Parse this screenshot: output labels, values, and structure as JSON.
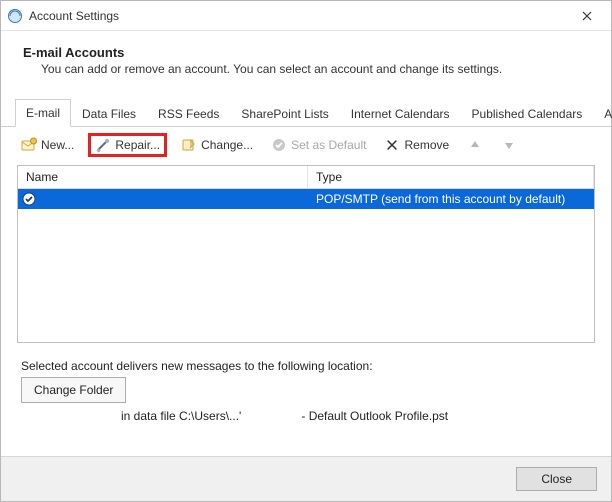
{
  "window": {
    "title": "Account Settings"
  },
  "header": {
    "title": "E-mail Accounts",
    "subtitle": "You can add or remove an account. You can select an account and change its settings."
  },
  "tabs": [
    {
      "label": "E-mail",
      "active": true
    },
    {
      "label": "Data Files"
    },
    {
      "label": "RSS Feeds"
    },
    {
      "label": "SharePoint Lists"
    },
    {
      "label": "Internet Calendars"
    },
    {
      "label": "Published Calendars"
    },
    {
      "label": "Address Books"
    }
  ],
  "toolbar": {
    "new_label": "New...",
    "repair_label": "Repair...",
    "change_label": "Change...",
    "set_default_label": "Set as Default",
    "remove_label": "Remove"
  },
  "columns": {
    "name": "Name",
    "type": "Type"
  },
  "accounts": [
    {
      "name": "",
      "type": "POP/SMTP (send from this account by default)",
      "is_default": true,
      "selected": true
    }
  ],
  "location": {
    "intro": "Selected account delivers new messages to the following location:",
    "change_folder_label": "Change Folder",
    "path_left": "in data file C:\\Users\\...'",
    "path_right": "- Default Outlook Profile.pst"
  },
  "footer": {
    "close_label": "Close"
  }
}
